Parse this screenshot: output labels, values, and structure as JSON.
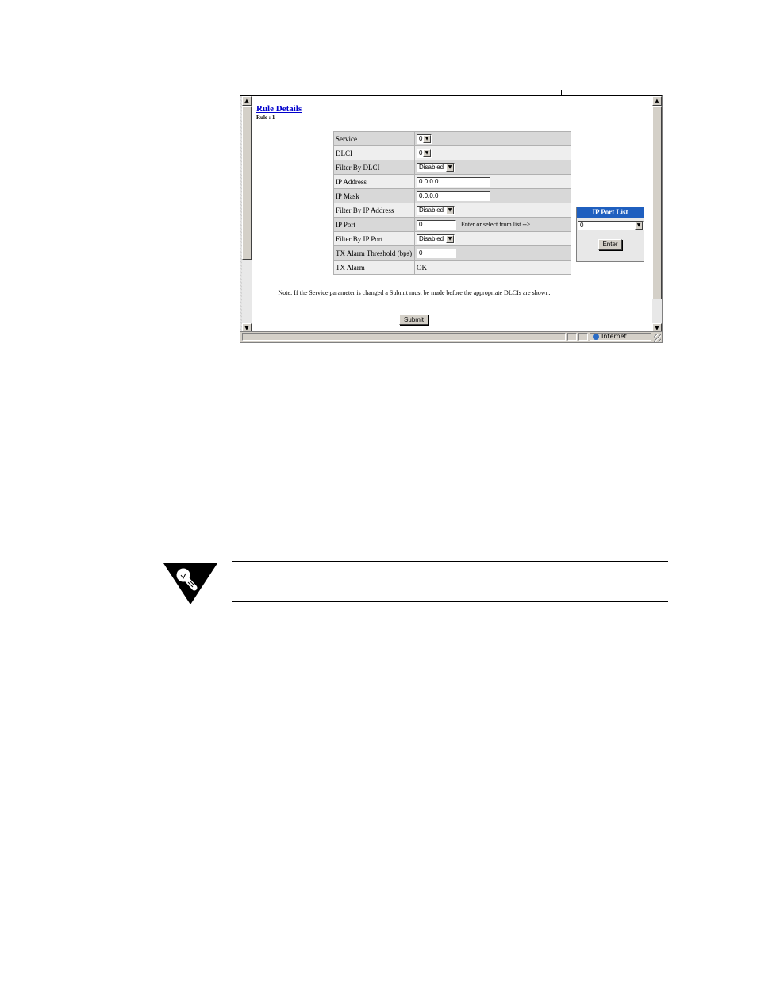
{
  "page": {
    "title": "Rule Details",
    "rule_label": "Rule : 1"
  },
  "form": {
    "rows": [
      {
        "label": "Service",
        "control": "select",
        "value": "0"
      },
      {
        "label": "DLCI",
        "control": "select",
        "value": "0"
      },
      {
        "label": "Filter By DLCI",
        "control": "select",
        "value": "Disabled"
      },
      {
        "label": "IP Address",
        "control": "text",
        "value": "0.0.0.0"
      },
      {
        "label": "IP Mask",
        "control": "text",
        "value": "0.0.0.0"
      },
      {
        "label": "Filter By IP Address",
        "control": "select",
        "value": "Disabled"
      },
      {
        "label": "IP Port",
        "control": "text",
        "value": "0",
        "hint": "Enter or select from list -->"
      },
      {
        "label": "Filter By IP Port",
        "control": "select",
        "value": "Disabled"
      },
      {
        "label": "TX Alarm Threshold (bps)",
        "control": "text",
        "value": "0"
      },
      {
        "label": "TX Alarm",
        "control": "static",
        "value": "OK"
      }
    ],
    "note": "Note:  If the Service parameter is changed a Submit must be made before the appropriate DLCIs are shown.",
    "submit_label": "Submit"
  },
  "ip_port_list": {
    "title": "IP Port List",
    "selected": "0",
    "enter_label": "Enter"
  },
  "statusbar": {
    "zone": "Internet"
  },
  "colors": {
    "link": "#0000cc",
    "panel_header": "#1f5fbf"
  },
  "icons": [
    "scroll-up-arrow-icon",
    "scroll-down-arrow-icon",
    "dropdown-arrow-icon",
    "globe-icon",
    "resize-grip-icon",
    "lightbulb-tip-icon"
  ]
}
